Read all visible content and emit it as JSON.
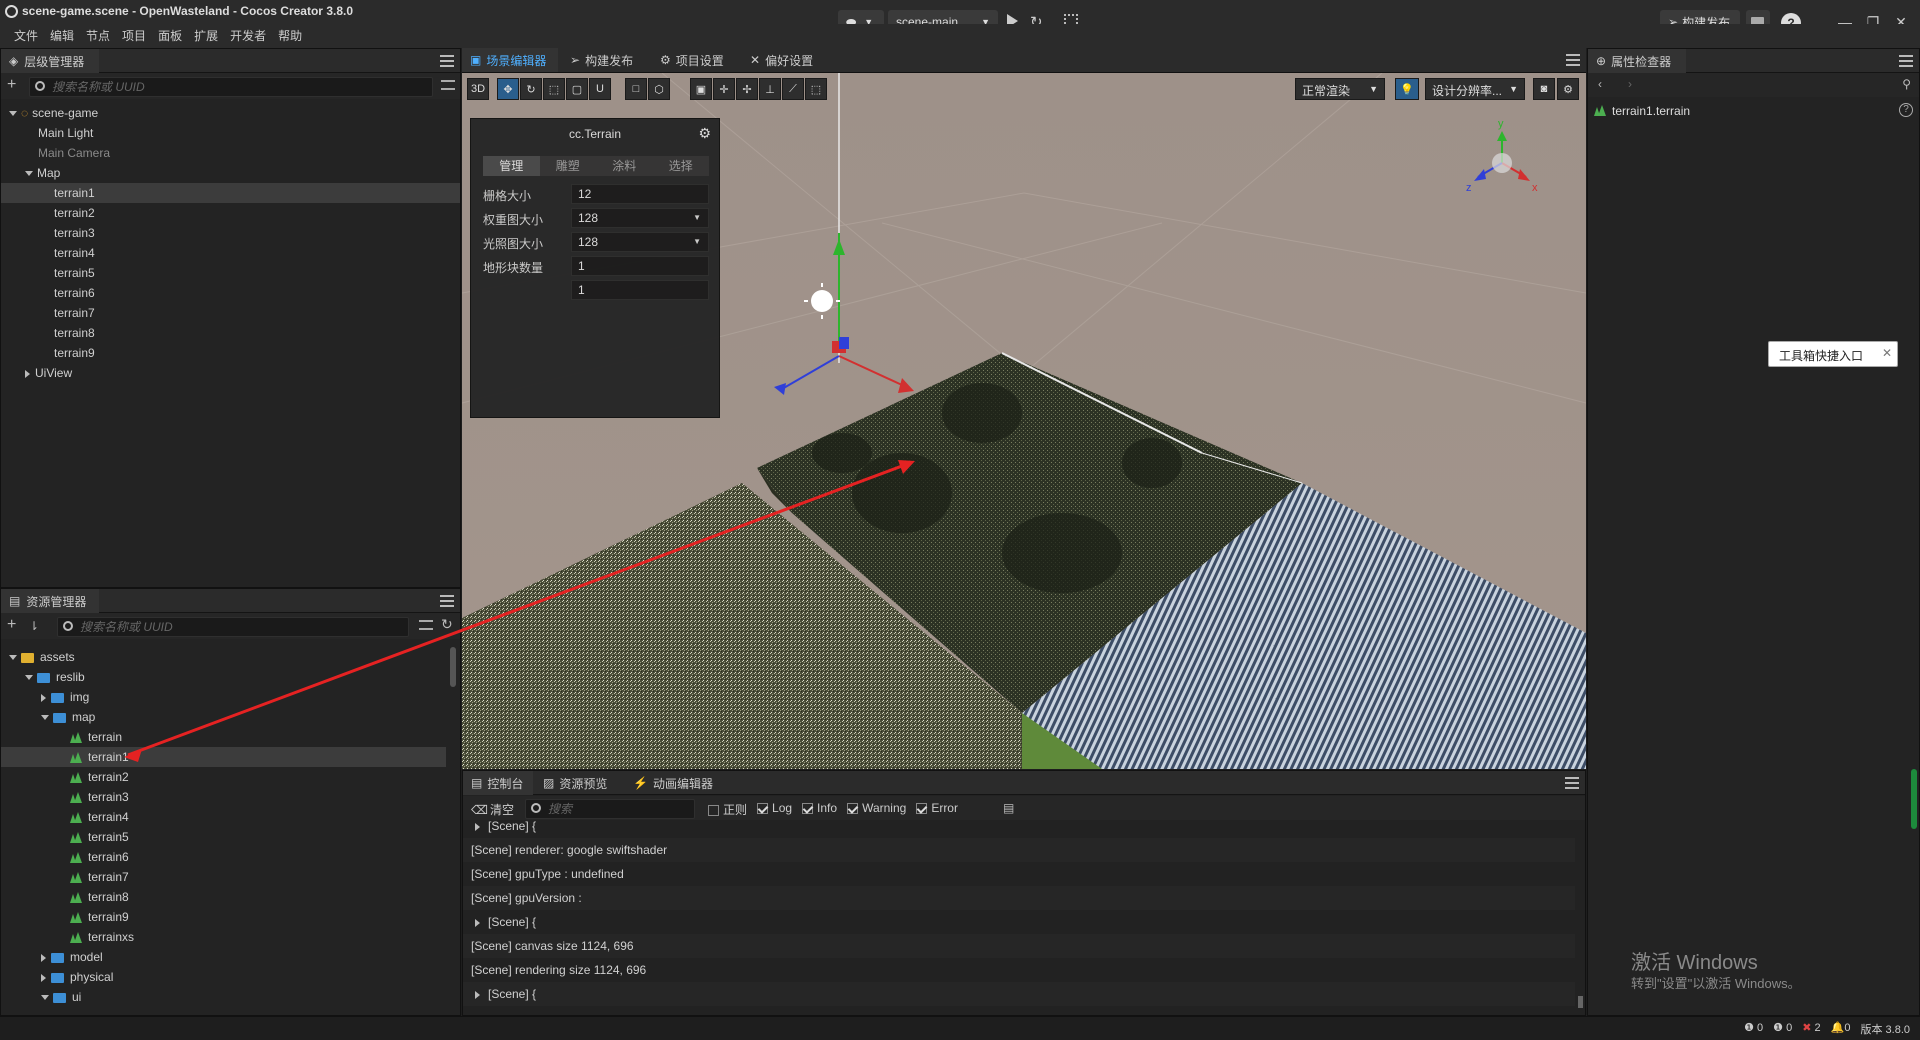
{
  "app": {
    "title": "scene-game.scene - OpenWasteland - Cocos Creator 3.8.0",
    "menu": [
      "文件",
      "编辑",
      "节点",
      "项目",
      "面板",
      "扩展",
      "开发者",
      "帮助"
    ],
    "scene_select": "scene-main",
    "build_button": "构建发布"
  },
  "hierarchy": {
    "tab": "层级管理器",
    "search_placeholder": "搜索名称或 UUID",
    "items": [
      {
        "label": "scene-game",
        "depth": 0,
        "expand": "down",
        "icon": "scene-icon"
      },
      {
        "label": "Main Light",
        "depth": 1
      },
      {
        "label": "Main Camera",
        "depth": 1,
        "dim": true
      },
      {
        "label": "Map",
        "depth": 1,
        "expand": "down"
      },
      {
        "label": "terrain1",
        "depth": 2,
        "selected": true
      },
      {
        "label": "terrain2",
        "depth": 2
      },
      {
        "label": "terrain3",
        "depth": 2
      },
      {
        "label": "terrain4",
        "depth": 2
      },
      {
        "label": "terrain5",
        "depth": 2
      },
      {
        "label": "terrain6",
        "depth": 2
      },
      {
        "label": "terrain7",
        "depth": 2
      },
      {
        "label": "terrain8",
        "depth": 2
      },
      {
        "label": "terrain9",
        "depth": 2
      },
      {
        "label": "UiView",
        "depth": 1,
        "expand": "right"
      }
    ]
  },
  "assets": {
    "tab": "资源管理器",
    "search_placeholder": "搜索名称或 UUID",
    "items": [
      {
        "label": "assets",
        "depth": 0,
        "expand": "down",
        "icon": "db"
      },
      {
        "label": "reslib",
        "depth": 1,
        "expand": "down",
        "icon": "folder"
      },
      {
        "label": "img",
        "depth": 2,
        "expand": "right",
        "icon": "folder"
      },
      {
        "label": "map",
        "depth": 2,
        "expand": "down",
        "icon": "folder"
      },
      {
        "label": "terrain",
        "depth": 3,
        "icon": "terrain"
      },
      {
        "label": "terrain1",
        "depth": 3,
        "icon": "terrain",
        "selected": true
      },
      {
        "label": "terrain2",
        "depth": 3,
        "icon": "terrain"
      },
      {
        "label": "terrain3",
        "depth": 3,
        "icon": "terrain"
      },
      {
        "label": "terrain4",
        "depth": 3,
        "icon": "terrain"
      },
      {
        "label": "terrain5",
        "depth": 3,
        "icon": "terrain"
      },
      {
        "label": "terrain6",
        "depth": 3,
        "icon": "terrain"
      },
      {
        "label": "terrain7",
        "depth": 3,
        "icon": "terrain"
      },
      {
        "label": "terrain8",
        "depth": 3,
        "icon": "terrain"
      },
      {
        "label": "terrain9",
        "depth": 3,
        "icon": "terrain"
      },
      {
        "label": "terrainxs",
        "depth": 3,
        "icon": "terrain"
      },
      {
        "label": "model",
        "depth": 2,
        "expand": "right",
        "icon": "folder"
      },
      {
        "label": "physical",
        "depth": 2,
        "expand": "right",
        "icon": "folder"
      },
      {
        "label": "ui",
        "depth": 2,
        "expand": "down",
        "icon": "folder"
      }
    ]
  },
  "center_tabs": [
    "场景编辑器",
    "构建发布",
    "项目设置",
    "偏好设置"
  ],
  "scene_toolbar": {
    "mode_3d": "3D",
    "render_mode": "正常渲染",
    "resolution": "设计分辨率..."
  },
  "terrain_panel": {
    "title": "cc.Terrain",
    "tabs": [
      "管理",
      "雕塑",
      "涂料",
      "选择"
    ],
    "rows": [
      {
        "label": "栅格大小",
        "value": "12"
      },
      {
        "label": "权重图大小",
        "value": "128"
      },
      {
        "label": "光照图大小",
        "value": "128"
      },
      {
        "label": "地形块数量",
        "value": "1"
      },
      {
        "label": "",
        "value": "1"
      }
    ]
  },
  "bottom_tabs": [
    "控制台",
    "资源预览",
    "动画编辑器"
  ],
  "console": {
    "clear": "清空",
    "search_placeholder": "搜索",
    "filters": [
      {
        "label": "正则",
        "checked": false
      },
      {
        "label": "Log",
        "checked": true
      },
      {
        "label": "Info",
        "checked": true
      },
      {
        "label": "Warning",
        "checked": true
      },
      {
        "label": "Error",
        "checked": true
      }
    ],
    "lines": [
      {
        "text": "[Scene] {",
        "collapsible": true
      },
      {
        "text": "[Scene] renderer: google swiftshader"
      },
      {
        "text": "[Scene] gpuType : undefined"
      },
      {
        "text": "[Scene] gpuVersion :"
      },
      {
        "text": "[Scene] {",
        "collapsible": true
      },
      {
        "text": "[Scene] canvas size 1124, 696"
      },
      {
        "text": "[Scene] rendering size 1124, 696"
      },
      {
        "text": "[Scene] {",
        "collapsible": true
      }
    ]
  },
  "inspector": {
    "tab": "属性检查器",
    "node": "terrain1.terrain",
    "toolbox_entry": "工具箱快捷入口"
  },
  "watermark": {
    "line1": "激活 Windows",
    "line2": "转到\"设置\"以激活 Windows。"
  },
  "status": {
    "counts": [
      "0",
      "0",
      "2"
    ],
    "notify": "0",
    "version": "版本 3.8.0"
  },
  "colors": {
    "accent": "#4fb0ff",
    "terrain_icon": "#4caf50",
    "error": "#e04444",
    "annotation_arrow": "#e52222"
  }
}
